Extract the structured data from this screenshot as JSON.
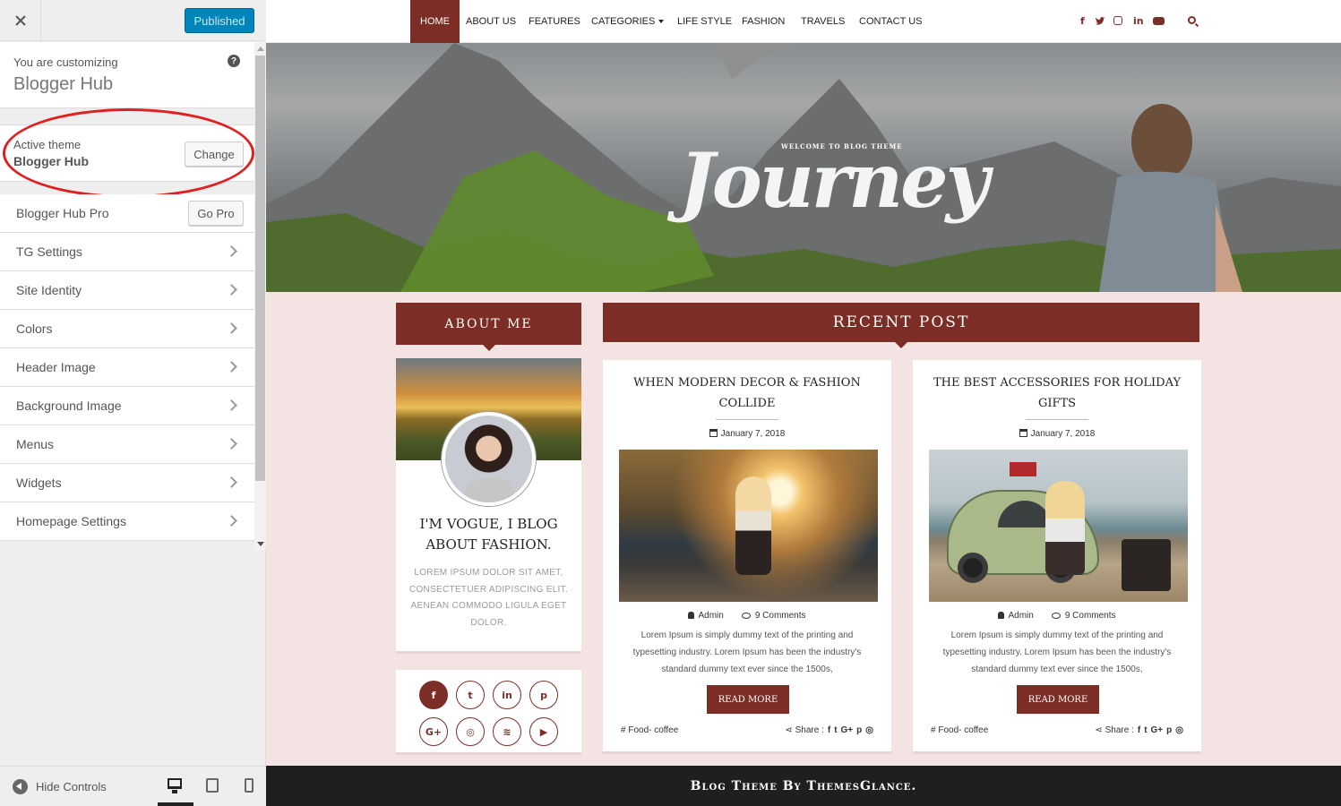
{
  "customizer": {
    "close_icon": "close-icon",
    "publish_label": "Published",
    "info": {
      "customizing_label": "You are customizing",
      "site_name": "Blogger Hub"
    },
    "help_icon": "help-icon",
    "theme": {
      "label": "Active theme",
      "name": "Blogger Hub",
      "change_label": "Change"
    },
    "pro": {
      "label": "Blogger Hub Pro",
      "button": "Go Pro"
    },
    "sections": [
      {
        "label": "TG Settings"
      },
      {
        "label": "Site Identity"
      },
      {
        "label": "Colors"
      },
      {
        "label": "Header Image"
      },
      {
        "label": "Background Image"
      },
      {
        "label": "Menus"
      },
      {
        "label": "Widgets"
      },
      {
        "label": "Homepage Settings"
      }
    ],
    "hide_controls_label": "Hide Controls",
    "devices": [
      "desktop-icon",
      "tablet-icon",
      "mobile-icon"
    ],
    "accent": "#0085ba",
    "annotation_color": "#e02020"
  },
  "site": {
    "accent": "#7b2d26",
    "nav": [
      {
        "label": "HOME"
      },
      {
        "label": "ABOUT US"
      },
      {
        "label": "FEATURES"
      },
      {
        "label": "CATEGORIES"
      },
      {
        "label": "LIFE STYLE"
      },
      {
        "label": "FASHION"
      },
      {
        "label": "TRAVELS"
      },
      {
        "label": "CONTACT US"
      }
    ],
    "nav_social": [
      "f",
      "t",
      "ig",
      "in",
      "yt"
    ],
    "hero": {
      "welcome": "WELCOME TO BLOG THEME",
      "title": "Journey"
    },
    "about": {
      "heading": "About Me",
      "title": "I'M VOGUE, I BLOG ABOUT FASHION.",
      "text": "LOREM IPSUM DOLOR SIT AMET, CONSECTETUER ADIPISCING ELIT. AENEAN COMMODO LIGULA EGET DOLOR."
    },
    "social_icons": [
      {
        "name": "facebook-icon",
        "glyph": "f"
      },
      {
        "name": "twitter-icon",
        "glyph": "t"
      },
      {
        "name": "linkedin-icon",
        "glyph": "in"
      },
      {
        "name": "pinterest-icon",
        "glyph": "p"
      },
      {
        "name": "google-plus-icon",
        "glyph": "G+"
      },
      {
        "name": "instagram-icon",
        "glyph": "◎"
      },
      {
        "name": "rss-icon",
        "glyph": "≋"
      },
      {
        "name": "youtube-icon",
        "glyph": "▶"
      }
    ],
    "recent_heading": "Recent Post",
    "posts": [
      {
        "title": "WHEN MODERN DECOR & FASHION COLLIDE",
        "date": "January 7, 2018",
        "author": "Admin",
        "comments": "9 Comments",
        "excerpt": "Lorem Ipsum is simply dummy text of the printing and typesetting industry. Lorem Ipsum has been the industry's standard dummy text ever since the 1500s,",
        "read_more": "READ MORE",
        "category": "Food- coffee",
        "share_label": "Share :"
      },
      {
        "title": "THE BEST ACCESSORIES FOR HOLIDAY GIFTS",
        "date": "January 7, 2018",
        "author": "Admin",
        "comments": "9 Comments",
        "excerpt": "Lorem Ipsum is simply dummy text of the printing and typesetting industry. Lorem Ipsum has been the industry's standard dummy text ever since the 1500s,",
        "read_more": "READ MORE",
        "category": "Food- coffee",
        "share_label": "Share :"
      }
    ],
    "footer": "Blog Theme By ThemesGlance."
  }
}
